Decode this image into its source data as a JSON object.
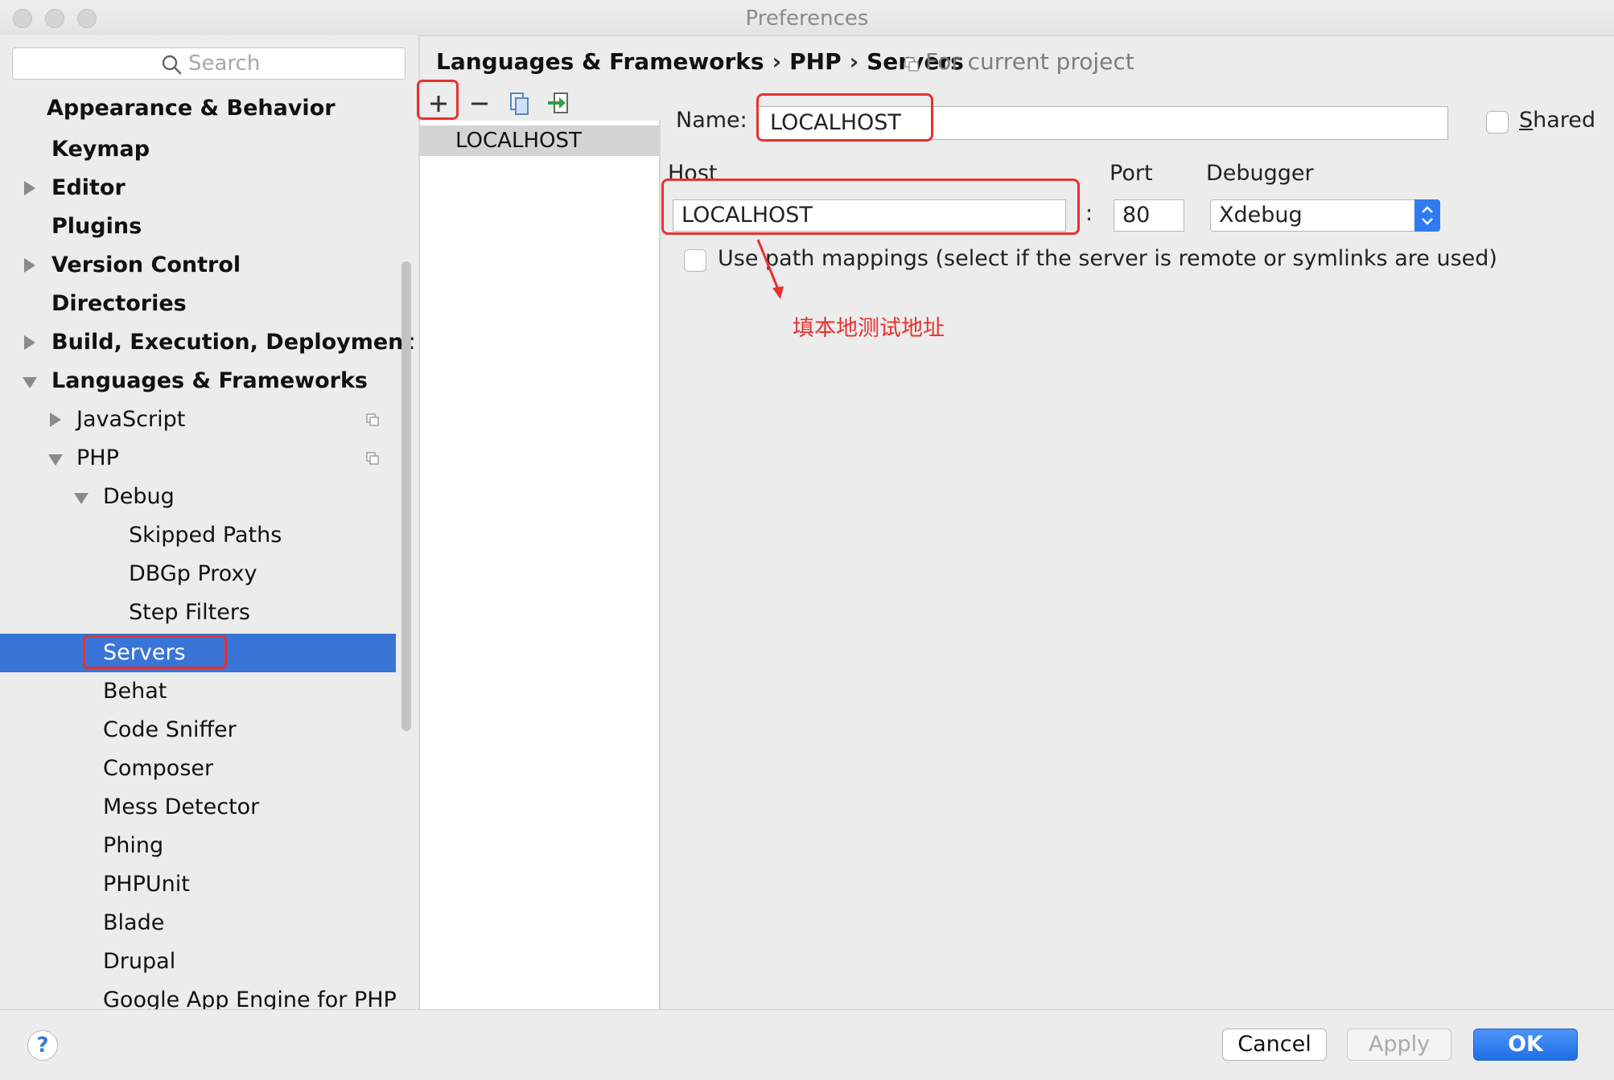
{
  "window": {
    "title": "Preferences"
  },
  "search": {
    "placeholder": "Search"
  },
  "sidebar": {
    "items": [
      {
        "label": "Appearance & Behavior"
      },
      {
        "label": "Keymap"
      },
      {
        "label": "Editor"
      },
      {
        "label": "Plugins"
      },
      {
        "label": "Version Control"
      },
      {
        "label": "Directories"
      },
      {
        "label": "Build, Execution, Deployment"
      },
      {
        "label": "Languages & Frameworks"
      },
      {
        "label": "JavaScript"
      },
      {
        "label": "PHP"
      },
      {
        "label": "Debug"
      },
      {
        "label": "Skipped Paths"
      },
      {
        "label": "DBGp Proxy"
      },
      {
        "label": "Step Filters"
      },
      {
        "label": "Servers"
      },
      {
        "label": "Behat"
      },
      {
        "label": "Code Sniffer"
      },
      {
        "label": "Composer"
      },
      {
        "label": "Mess Detector"
      },
      {
        "label": "Phing"
      },
      {
        "label": "PHPUnit"
      },
      {
        "label": "Blade"
      },
      {
        "label": "Drupal"
      },
      {
        "label": "Google App Engine for PHP"
      }
    ]
  },
  "breadcrumb": {
    "parts": [
      "Languages & Frameworks",
      "PHP",
      "Servers"
    ],
    "separator": "›",
    "scope": "For current project"
  },
  "server_list": {
    "items": [
      "LOCALHOST"
    ]
  },
  "form": {
    "name_label": "Name:",
    "name_value": "LOCALHOST",
    "shared_mnemonic": "S",
    "shared_rest": "hared",
    "host_label": "Host",
    "host_value": "LOCALHOST",
    "colon": ":",
    "port_label": "Port",
    "port_value": "80",
    "debugger_label": "Debugger",
    "debugger_value": "Xdebug",
    "path_mappings_label": "Use path mappings (select if the server is remote or symlinks are used)"
  },
  "annotation": {
    "text": "填本地测试地址"
  },
  "buttons": {
    "help": "?",
    "cancel": "Cancel",
    "apply": "Apply",
    "ok": "OK"
  },
  "colors": {
    "selection": "#3875d6",
    "highlight_red": "#e8312f",
    "ok_blue": "#1f6fe6"
  }
}
